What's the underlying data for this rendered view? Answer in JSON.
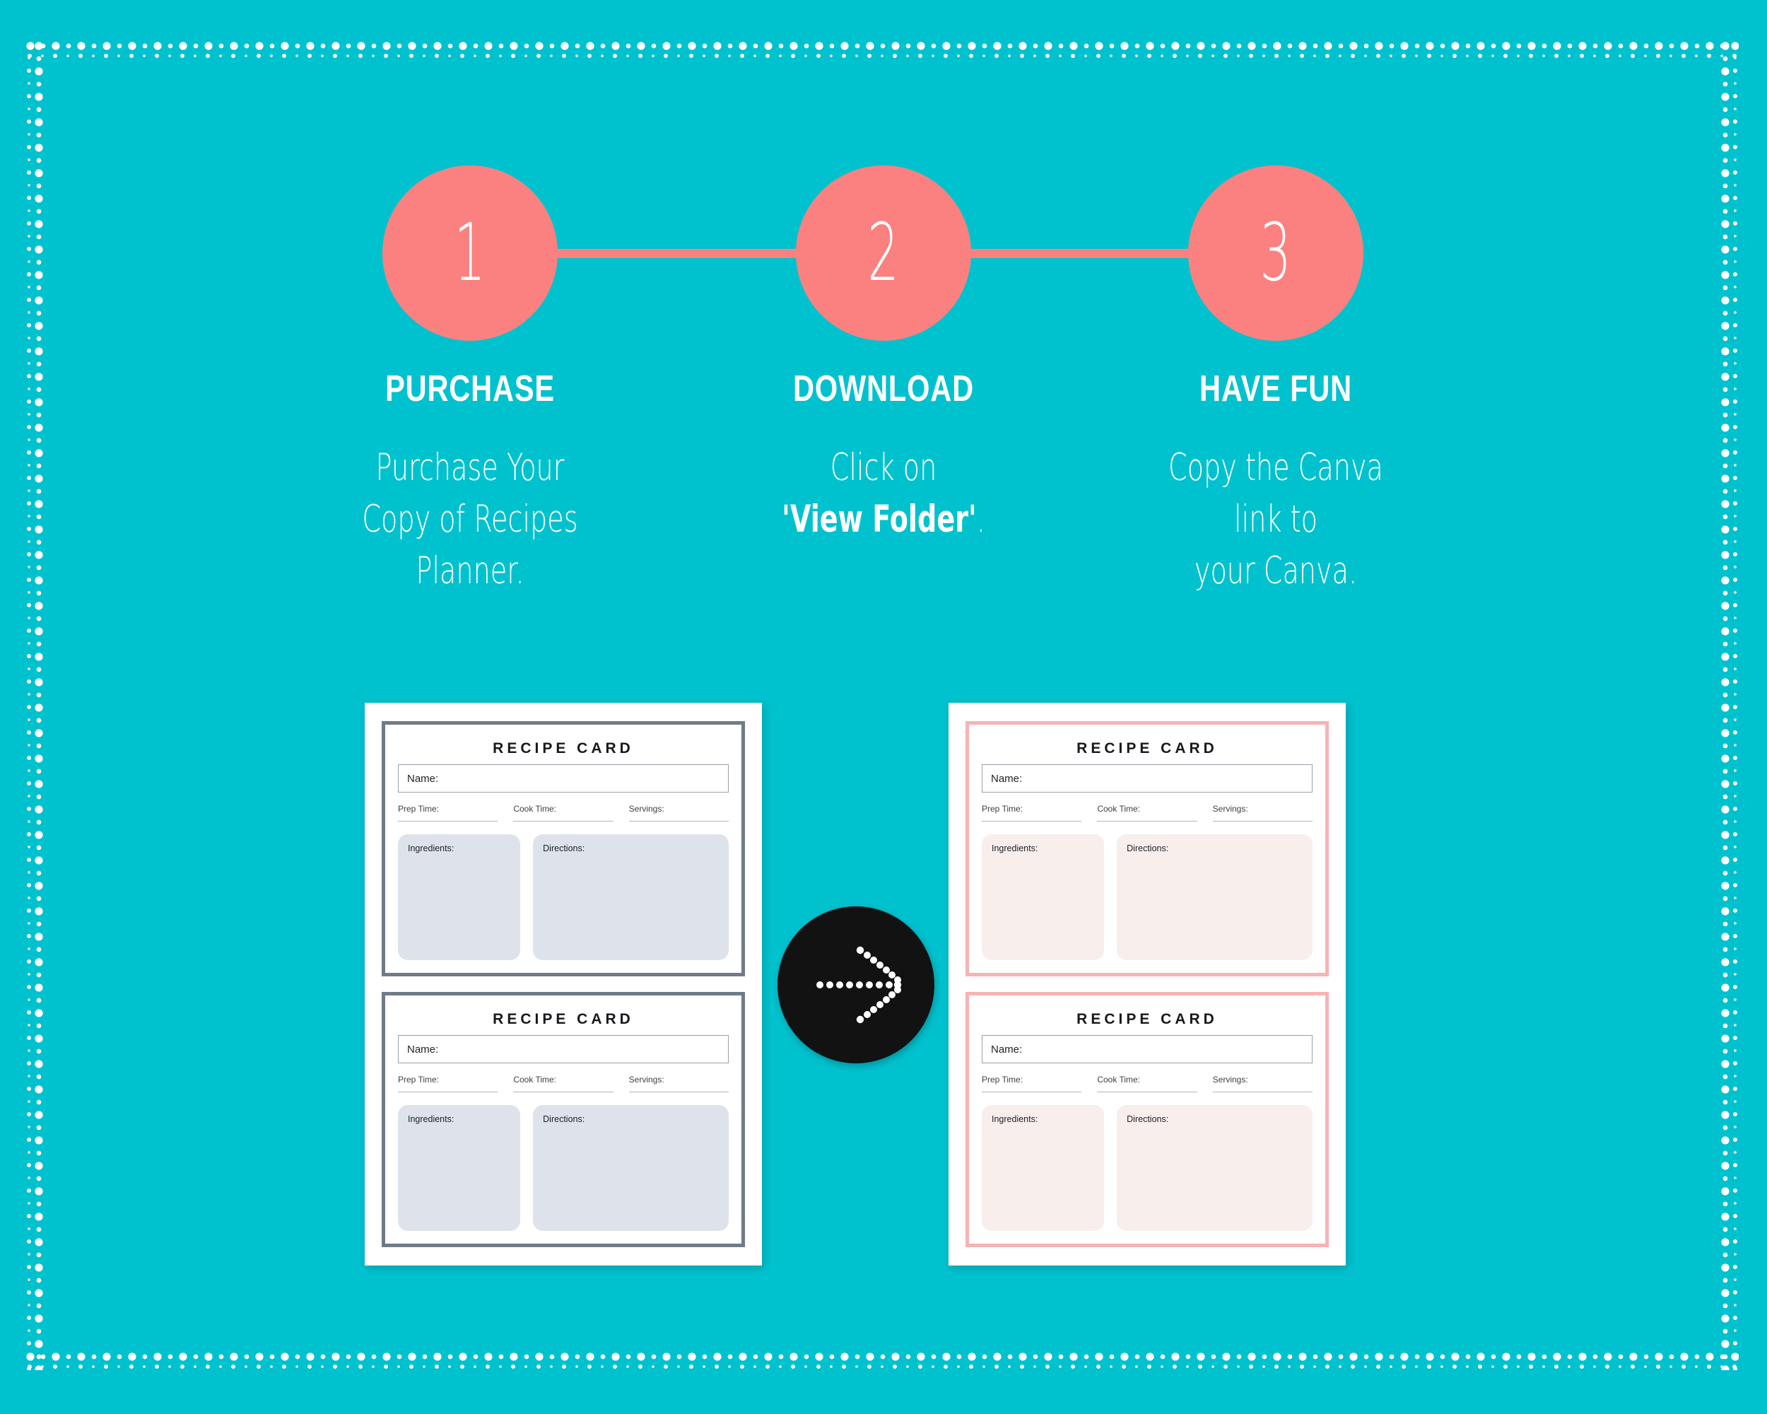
{
  "theme": {
    "background": "#00c2ce",
    "accent": "#fb8180",
    "text_on_accent": "#ffffff",
    "gray_card_border": "#6f7b89",
    "gray_card_fill": "#dee2ea",
    "pink_card_border": "#f8b3b3",
    "pink_card_fill": "#f8eeec",
    "badge_background": "#121212"
  },
  "steps": [
    {
      "number": "1",
      "title": "PURCHASE",
      "lines": [
        "Purchase Your",
        "Copy of Recipes",
        "Planner."
      ]
    },
    {
      "number": "2",
      "title": "DOWNLOAD",
      "lines": [
        "Click  on"
      ],
      "bold_line": "'View Folder'",
      "bold_suffix": "."
    },
    {
      "number": "3",
      "title": "HAVE FUN",
      "lines": [
        "Copy the Canva",
        "link to",
        "your Canva."
      ]
    }
  ],
  "preview": {
    "left_sheet": {
      "style": "gray",
      "cards": [
        {
          "title": "RECIPE CARD",
          "name_label": "Name:",
          "prep_label": "Prep Time:",
          "cook_label": "Cook Time:",
          "servings_label": "Servings:",
          "ingredients_label": "Ingredients:",
          "directions_label": "Directions:"
        },
        {
          "title": "RECIPE CARD",
          "name_label": "Name:",
          "prep_label": "Prep Time:",
          "cook_label": "Cook Time:",
          "servings_label": "Servings:",
          "ingredients_label": "Ingredients:",
          "directions_label": "Directions:"
        }
      ]
    },
    "right_sheet": {
      "style": "pink",
      "cards": [
        {
          "title": "RECIPE CARD",
          "name_label": "Name:",
          "prep_label": "Prep Time:",
          "cook_label": "Cook Time:",
          "servings_label": "Servings:",
          "ingredients_label": "Ingredients:",
          "directions_label": "Directions:"
        },
        {
          "title": "RECIPE CARD",
          "name_label": "Name:",
          "prep_label": "Prep Time:",
          "cook_label": "Cook Time:",
          "servings_label": "Servings:",
          "ingredients_label": "Ingredients:",
          "directions_label": "Directions:"
        }
      ]
    },
    "transform_badge": {
      "icon": "dotted-arrow-right-icon"
    }
  }
}
